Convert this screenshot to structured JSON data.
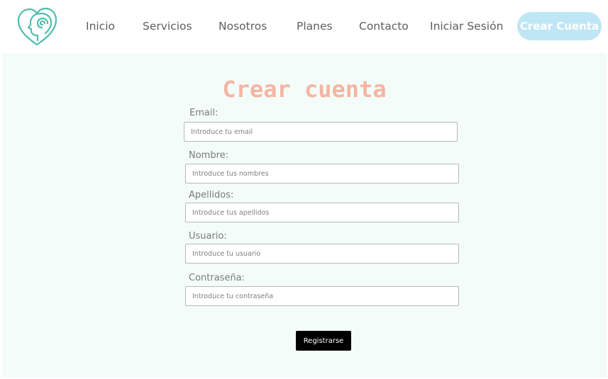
{
  "nav": {
    "links": [
      {
        "label": "Inicio"
      },
      {
        "label": "Servicios"
      },
      {
        "label": "Nosotros"
      },
      {
        "label": "Planes"
      },
      {
        "label": "Contacto"
      },
      {
        "label": "Iniciar Sesión"
      }
    ],
    "cta_label": "Crear Cuenta",
    "logo_icon": "heart-head-spiral-icon"
  },
  "form": {
    "title": "Crear cuenta",
    "fields": [
      {
        "label": "Email:",
        "placeholder": "Introduce tu email",
        "value": ""
      },
      {
        "label": "Nombre:",
        "placeholder": "Introduce tus nombres",
        "value": ""
      },
      {
        "label": "Apellidos:",
        "placeholder": "Introduce tus apellidos",
        "value": ""
      },
      {
        "label": "Usuario:",
        "placeholder": "Introduce tu usuario",
        "value": ""
      },
      {
        "label": "Contraseña:",
        "placeholder": "Introduce tu contraseña",
        "value": ""
      }
    ],
    "submit_label": "Registrarse"
  },
  "colors": {
    "accent_teal": "#4fbfae",
    "title_coral": "#f5b5a3",
    "cta_bg": "#bfe6f5",
    "form_bg": "#f4fcf9",
    "submit_bg": "#000000"
  }
}
